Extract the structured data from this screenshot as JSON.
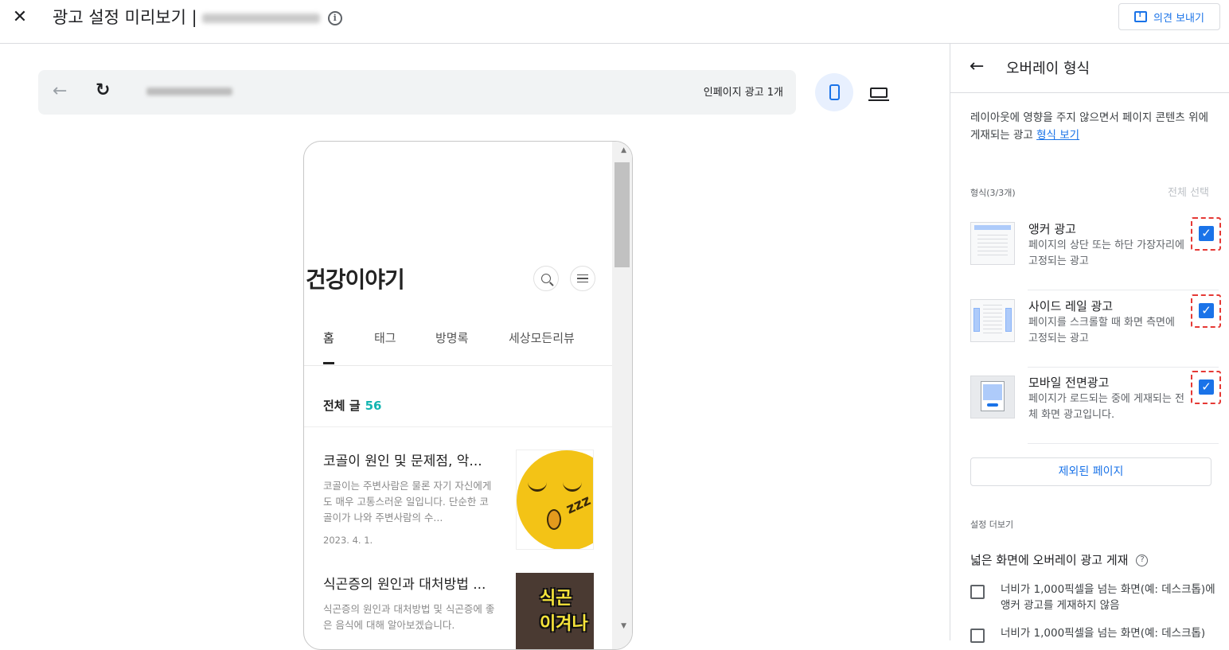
{
  "header": {
    "close_icon": "close-icon",
    "title": "광고 설정 미리보기 |",
    "info_icon": "info-icon",
    "feedback_label": "의견 보내기"
  },
  "preview_bar": {
    "ad_count": "인페이지 광고 1개",
    "device_options": [
      "mobile",
      "desktop"
    ],
    "selected_device": "mobile"
  },
  "blog": {
    "title": "건강이야기",
    "tabs": [
      "홈",
      "태그",
      "방명록",
      "세상모든리뷰"
    ],
    "active_tab": "홈",
    "post_count_label": "전체 글",
    "post_count": "56",
    "posts": [
      {
        "title": "코골이 원인 및 문제점, 악...",
        "excerpt": "코골이는 주변사람은 물론 자기 자신에게도 매우 고통스러운 일입니다. 단순한 코골이가 나와 주변사람의 수...",
        "date": "2023. 4. 1."
      },
      {
        "title": "식곤증의 원인과 대처방법 ...",
        "excerpt": "식곤증의 원인과 대처방법 및 식곤증에 좋은 음식에 대해 알아보겠습니다.",
        "thumb_text": [
          "식곤",
          "이겨나"
        ]
      }
    ]
  },
  "panel": {
    "title": "오버레이 형식",
    "description": "레이아웃에 영향을 주지 않으면서 페이지 콘텐츠 위에 게재되는 광고",
    "description_link": "형식 보기",
    "formats_label": "형식(3/3개)",
    "select_all": "전체 선택",
    "formats": [
      {
        "name": "앵커 광고",
        "desc": "페이지의 상단 또는 하단 가장자리에 고정되는 광고",
        "checked": true
      },
      {
        "name": "사이드 레일 광고",
        "desc": "페이지를 스크롤할 때 화면 측면에 고정되는 광고",
        "checked": true
      },
      {
        "name": "모바일 전면광고",
        "desc": "페이지가 로드되는 중에 게재되는 전체 화면 광고입니다.",
        "checked": true
      }
    ],
    "excluded_pages": "제외된 페이지",
    "more_settings": "설정 더보기",
    "wide_screen_title": "넓은 화면에 오버레이 광고 게재",
    "wide_options": [
      {
        "text": "너비가 1,000픽셀을 넘는 화면(예: 데스크톱)에 앵커 광고를 게재하지 않음",
        "checked": false
      },
      {
        "text": "너비가 1,000픽셀을 넘는 화면(예: 데스크톱)",
        "checked": false
      }
    ]
  },
  "colors": {
    "accent": "#1a73e8",
    "highlight_border": "#e53935",
    "post_count": "#13b5b1"
  }
}
